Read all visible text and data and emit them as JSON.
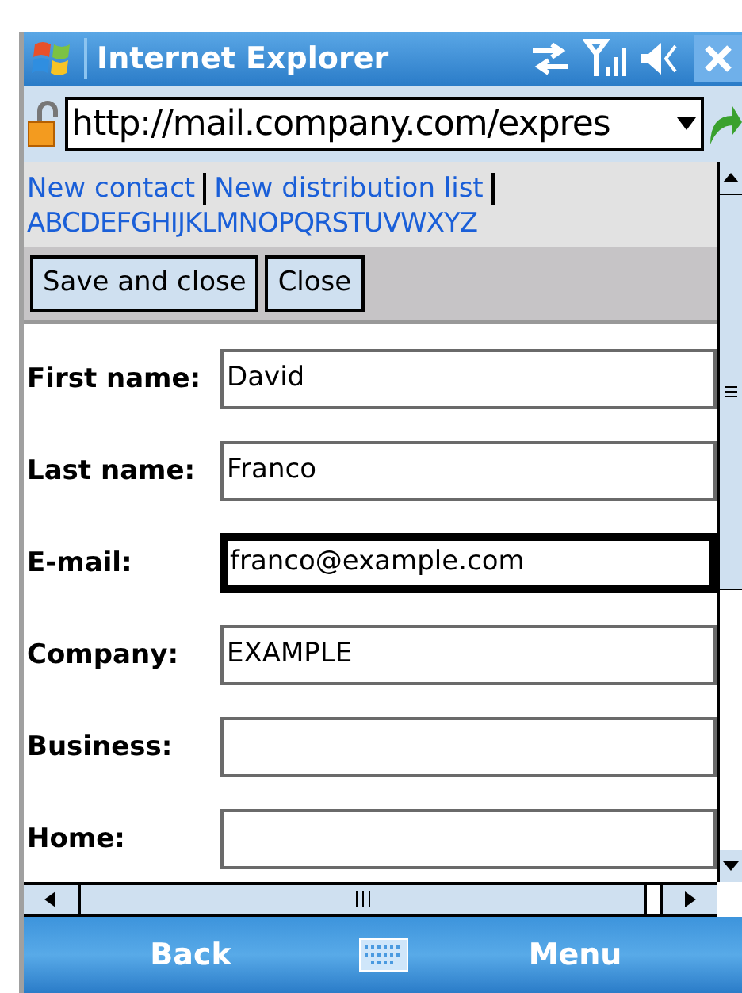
{
  "window": {
    "title": "Internet Explorer"
  },
  "address_bar": {
    "value": "http://mail.company.com/expres"
  },
  "links": [
    {
      "label": "New contact"
    },
    {
      "label": "New distribution list"
    }
  ],
  "alphabet": "ABCDEFGHIJKLMNOPQRSTUVWXYZ",
  "buttons": [
    "Save and close",
    "Close"
  ],
  "fields": [
    {
      "label": "First name:",
      "value": "David",
      "focused": false
    },
    {
      "label": "Last name:",
      "value": "Franco",
      "focused": false
    },
    {
      "label": "E-mail:",
      "value": "franco@example.com",
      "focused": true
    },
    {
      "label": "Company:",
      "value": "EXAMPLE",
      "focused": false
    },
    {
      "label": "Business:",
      "focused": false
    },
    {
      "label": "Home:",
      "focused": false
    }
  ],
  "softkeys": {
    "left": "Back",
    "right": "Menu"
  }
}
